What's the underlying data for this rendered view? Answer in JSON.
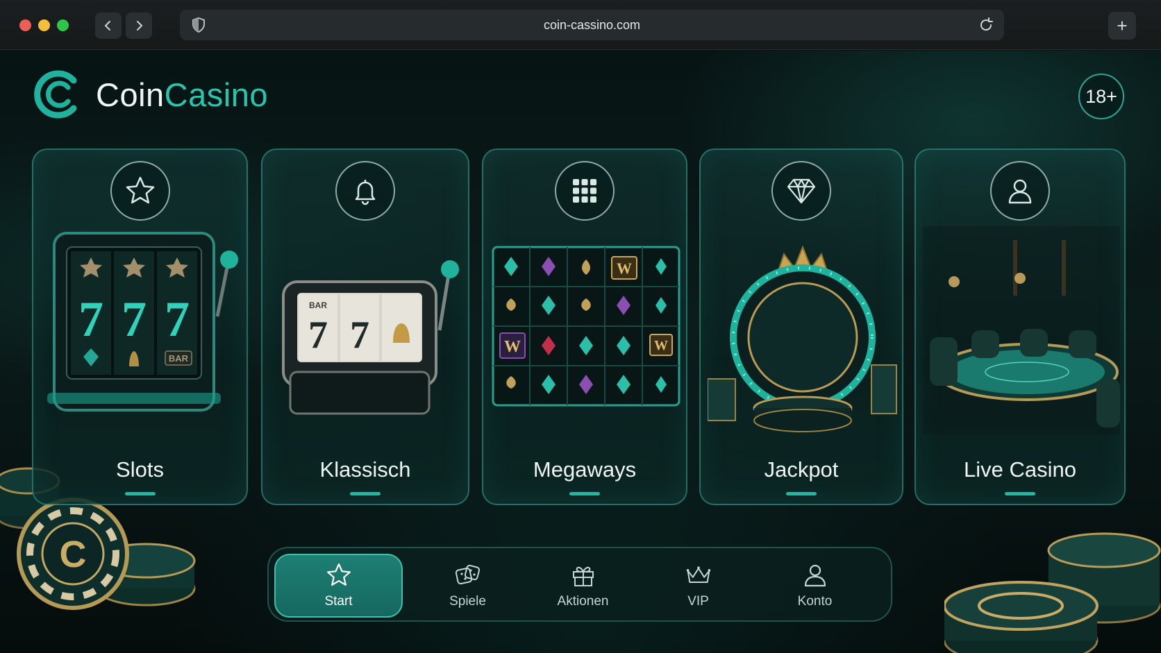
{
  "browser": {
    "url": "coin-cassino.com",
    "traffic_colors": [
      "#ec5f55",
      "#f4bd3a",
      "#2fc54b"
    ]
  },
  "brand": {
    "name_part1": "Coin",
    "name_part2": "Casino",
    "accent": "#27c4ae"
  },
  "age_badge": "18+",
  "categories": [
    {
      "label": "Slots",
      "icon": "star-icon"
    },
    {
      "label": "Klassisch",
      "icon": "bell-icon"
    },
    {
      "label": "Megaways",
      "icon": "grid-icon"
    },
    {
      "label": "Jackpot",
      "icon": "diamond-icon"
    },
    {
      "label": "Live Casino",
      "icon": "user-icon"
    }
  ],
  "bottom_nav": {
    "active": "Start",
    "items": [
      {
        "label": "Start",
        "icon": "star-icon"
      },
      {
        "label": "Spiele",
        "icon": "dice-icon"
      },
      {
        "label": "Aktionen",
        "icon": "gift-icon"
      },
      {
        "label": "VIP",
        "icon": "crown-icon"
      },
      {
        "label": "Konto",
        "icon": "user-icon"
      }
    ]
  },
  "slot_art": {
    "reel_symbols": [
      "7",
      "7",
      "7"
    ],
    "bar_text": "BAR",
    "wild_text": "W"
  }
}
